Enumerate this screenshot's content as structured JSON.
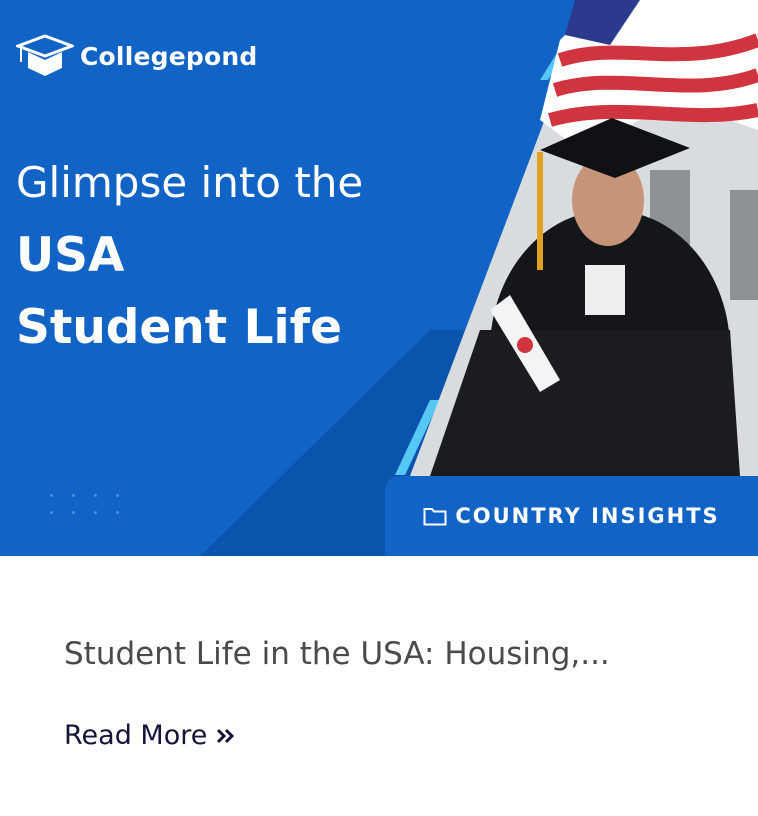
{
  "banner": {
    "brand": "Collegepond",
    "headline_light": "Glimpse into the",
    "headline_bold_1": "USA",
    "headline_bold_2": "Student Life"
  },
  "category": {
    "icon": "folder-icon",
    "label": "COUNTRY INSIGHTS"
  },
  "post": {
    "title": "Student Life in the USA: Housing,...",
    "read_more": "Read More",
    "read_more_icon": "double-chevron-right-icon"
  },
  "colors": {
    "brand_blue": "#1163c6",
    "accent_cyan": "#56c8f5",
    "title_gray": "#4a4a4a",
    "link_navy": "#14143a"
  }
}
